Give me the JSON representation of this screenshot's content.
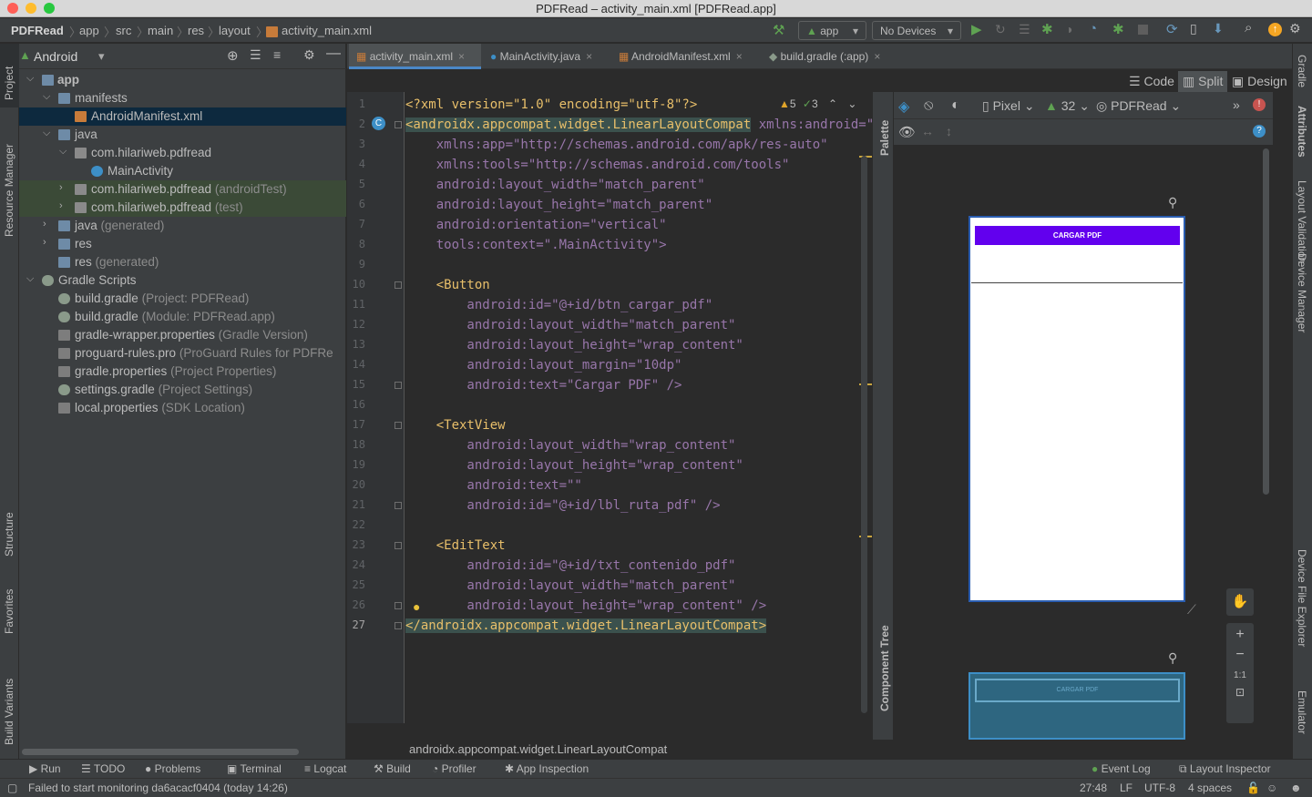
{
  "window": {
    "title": "PDFRead – activity_main.xml [PDFRead.app]"
  },
  "breadcrumb": [
    "PDFRead",
    "app",
    "src",
    "main",
    "res",
    "layout",
    "activity_main.xml"
  ],
  "toolbar": {
    "run_config": "app",
    "device": "No Devices"
  },
  "left_stripe": [
    "Project",
    "Resource Manager",
    "Structure",
    "Favorites",
    "Build Variants"
  ],
  "project": {
    "view": "Android",
    "tree": [
      {
        "label": "app",
        "sub": "",
        "arrow": "v",
        "icon": "folder-icon"
      },
      {
        "label": "manifests",
        "sub": "",
        "arrow": "v",
        "icon": "folder-icon"
      },
      {
        "label": "AndroidManifest.xml",
        "sub": "",
        "arrow": "",
        "icon": "manifest-file-icon"
      },
      {
        "label": "java",
        "sub": "",
        "arrow": "v",
        "icon": "folder-icon"
      },
      {
        "label": "com.hilariweb.pdfread",
        "sub": "",
        "arrow": "v",
        "icon": "package-icon"
      },
      {
        "label": "MainActivity",
        "sub": "",
        "arrow": "",
        "icon": "class-icon"
      },
      {
        "label": "com.hilariweb.pdfread",
        "sub": "(androidTest)",
        "arrow": ">",
        "icon": "package-icon"
      },
      {
        "label": "com.hilariweb.pdfread",
        "sub": "(test)",
        "arrow": ">",
        "icon": "package-icon"
      },
      {
        "label": "java",
        "sub": "(generated)",
        "arrow": ">",
        "icon": "folder-icon"
      },
      {
        "label": "res",
        "sub": "",
        "arrow": ">",
        "icon": "folder-icon"
      },
      {
        "label": "res",
        "sub": "(generated)",
        "arrow": "",
        "icon": "folder-icon"
      },
      {
        "label": "Gradle Scripts",
        "sub": "",
        "arrow": "v",
        "icon": "gradle-icon"
      },
      {
        "label": "build.gradle",
        "sub": "(Project: PDFRead)",
        "arrow": "",
        "icon": "gradle-icon"
      },
      {
        "label": "build.gradle",
        "sub": "(Module: PDFRead.app)",
        "arrow": "",
        "icon": "gradle-icon"
      },
      {
        "label": "gradle-wrapper.properties",
        "sub": "(Gradle Version)",
        "arrow": "",
        "icon": "properties-icon"
      },
      {
        "label": "proguard-rules.pro",
        "sub": "(ProGuard Rules for PDFRe",
        "arrow": "",
        "icon": "file-icon"
      },
      {
        "label": "gradle.properties",
        "sub": "(Project Properties)",
        "arrow": "",
        "icon": "properties-icon"
      },
      {
        "label": "settings.gradle",
        "sub": "(Project Settings)",
        "arrow": "",
        "icon": "gradle-icon"
      },
      {
        "label": "local.properties",
        "sub": "(SDK Location)",
        "arrow": "",
        "icon": "properties-icon"
      }
    ]
  },
  "editor_tabs": [
    "activity_main.xml",
    "MainActivity.java",
    "AndroidManifest.xml",
    "build.gradle (:app)"
  ],
  "modes": {
    "code": "Code",
    "split": "Split",
    "design": "Design"
  },
  "inspections": {
    "warnings": "5",
    "weak_warnings": "3"
  },
  "code_lines": [
    "1",
    "2",
    "3",
    "4",
    "5",
    "6",
    "7",
    "8",
    "9",
    "10",
    "11",
    "12",
    "13",
    "14",
    "15",
    "16",
    "17",
    "18",
    "19",
    "20",
    "21",
    "22",
    "23",
    "24",
    "25",
    "26",
    "27"
  ],
  "code": {
    "l1": "<?xml version=\"1.0\" encoding=\"utf-8\"?>",
    "l2_tag": "<androidx.appcompat.widget.LinearLayoutCompat",
    "l2_attr": " xmlns:android=\"htt",
    "l3": "    xmlns:app=\"http://schemas.android.com/apk/res-auto\"",
    "l4": "    xmlns:tools=\"http://schemas.android.com/tools\"",
    "l5": "    android:layout_width=\"match_parent\"",
    "l6": "    android:layout_height=\"match_parent\"",
    "l7": "    android:orientation=\"vertical\"",
    "l8": "    tools:context=\".MainActivity\">",
    "l10": "    <Button",
    "l11": "        android:id=\"@+id/btn_cargar_pdf\"",
    "l12": "        android:layout_width=\"match_parent\"",
    "l13": "        android:layout_height=\"wrap_content\"",
    "l14": "        android:layout_margin=\"10dp\"",
    "l15": "        android:text=\"Cargar PDF\" />",
    "l17": "    <TextView",
    "l18": "        android:layout_width=\"wrap_content\"",
    "l19": "        android:layout_height=\"wrap_content\"",
    "l20": "        android:text=\"\"",
    "l21": "        android:id=\"@+id/lbl_ruta_pdf\" />",
    "l23": "    <EditText",
    "l24": "        android:id=\"@+id/txt_contenido_pdf\"",
    "l25": "        android:layout_width=\"match_parent\"",
    "l26": "        android:layout_height=\"wrap_content\" />",
    "l27": "</androidx.appcompat.widget.LinearLayoutCompat>"
  },
  "code_footer": "androidx.appcompat.widget.LinearLayoutCompat",
  "palette_tabs": {
    "palette": "Palette",
    "component_tree": "Component Tree"
  },
  "design": {
    "device": "Pixel",
    "api": "32",
    "theme": "PDFRead",
    "button_text": "CARGAR PDF",
    "zoom_label": "1:1"
  },
  "right_stripe": [
    "Gradle",
    "Attributes",
    "Layout Validation",
    "Device Manager",
    "Device File Explorer",
    "Emulator"
  ],
  "bottom_tools": [
    "Run",
    "TODO",
    "Problems",
    "Terminal",
    "Logcat",
    "Build",
    "Profiler",
    "App Inspection"
  ],
  "bottom_right_tools": [
    "Event Log",
    "Layout Inspector"
  ],
  "status": {
    "message": "Failed to start monitoring da6acacf0404 (today 14:26)",
    "position": "27:48",
    "line_sep": "LF",
    "encoding": "UTF-8",
    "indent": "4 spaces"
  },
  "colors": {
    "accent": "#4a88c7",
    "button_purple": "#6200ee",
    "warning": "#e0a42a",
    "error": "#c75450"
  }
}
